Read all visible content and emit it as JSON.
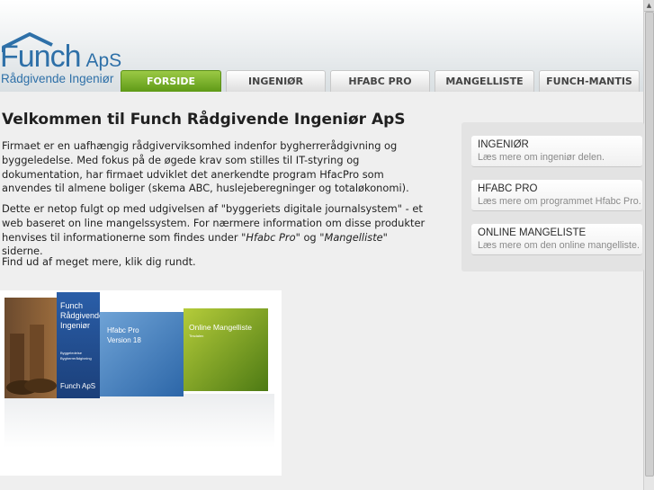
{
  "logo": {
    "name": "Funch",
    "suffix": "ApS",
    "subtitle": "Rådgivende Ingeniør"
  },
  "nav": {
    "tabs": [
      {
        "label": "FORSIDE",
        "active": true
      },
      {
        "label": "INGENIØR",
        "active": false
      },
      {
        "label": "HFABC PRO",
        "active": false
      },
      {
        "label": "MANGELLISTE",
        "active": false
      },
      {
        "label": "FUNCH-MANTIS",
        "active": false
      }
    ]
  },
  "main": {
    "title": "Velkommen til Funch Rådgivende Ingeniør ApS",
    "para1": "Firmaet er en uafhængig rådgiverviksomhed indenfor bygherrerådgivning og byggeledelse. Med fokus på de øgede krav som stilles til IT-styring og dokumentation, har firmaet udviklet det anerkendte program HfacPro som anvendes til almene boliger (skema ABC, huslejeberegninger og totaløkonomi).",
    "para2_a": "Dette er netop fulgt op med udgivelsen af \"byggeriets digitale journalsystem\" - et web baseret on line mangelssystem. For nærmere information om disse produkter henvises til informationerne som findes under \"",
    "para2_link1": "Hfabc Pro",
    "para2_b": "\" og \"",
    "para2_link2": "Mangelliste",
    "para2_c": "\" siderne.",
    "para3": "Find ud af meget mere, klik dig rundt."
  },
  "sidebar": {
    "boxes": [
      {
        "title": "INGENIØR",
        "desc": "Læs mere om ingeniør delen."
      },
      {
        "title": "HFABC PRO",
        "desc": "Læs mere om programmet Hfabc Pro."
      },
      {
        "title": "ONLINE MANGELISTE",
        "desc": "Læs mere om den online mangelliste."
      }
    ]
  },
  "products": {
    "box1": {
      "line1": "Funch",
      "line2": "Rådgivende",
      "line3": "Ingeniør",
      "small1": "Byggeledelse",
      "small2": "Bygherrerådgivning",
      "brand": "Funch ApS"
    },
    "box2": {
      "line1": "Hfabc Pro",
      "line2": "Version 18"
    },
    "box3": {
      "line1": "Online Mangelliste",
      "line2": "Tirsdalen"
    }
  },
  "colors": {
    "brand_blue": "#2e70a8",
    "active_tab_green": "#6fa81f"
  },
  "icons": {
    "logo": "house-roof-icon",
    "scroll_up": "arrow-up-icon"
  }
}
